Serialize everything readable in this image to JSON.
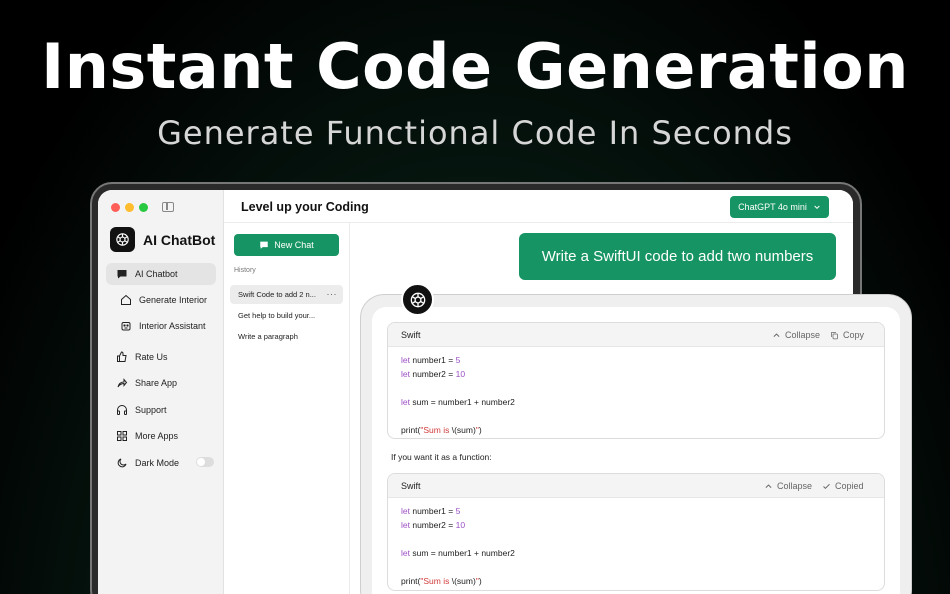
{
  "hero": {
    "title": "Instant Code Generation",
    "subtitle": "Generate Functional Code In Seconds"
  },
  "colors": {
    "accent": "#179463",
    "traffic_red": "#ff5f57",
    "traffic_yellow": "#febc2e",
    "traffic_green": "#28c840"
  },
  "sidebar": {
    "brand": "AI ChatBot",
    "items": [
      {
        "label": "AI Chatbot",
        "icon": "chat-bubble-icon"
      },
      {
        "label": "Generate Interior",
        "icon": "home-icon"
      },
      {
        "label": "Interior Assistant",
        "icon": "robot-icon"
      },
      {
        "label": "Rate Us",
        "icon": "thumbs-up-icon"
      },
      {
        "label": "Share App",
        "icon": "share-icon"
      },
      {
        "label": "Support",
        "icon": "headphones-icon"
      },
      {
        "label": "More Apps",
        "icon": "grid-icon"
      },
      {
        "label": "Dark Mode",
        "icon": "moon-icon"
      }
    ]
  },
  "topbar": {
    "title": "Level up your Coding",
    "model": "ChatGPT 4o mini"
  },
  "history": {
    "new_chat": "New Chat",
    "label": "History",
    "items": [
      "Swift Code to add 2 n...",
      "Get help to build your...",
      "Write a paragraph"
    ],
    "more": "···"
  },
  "chat": {
    "prompt": "Write a SwiftUI code to add two numbers",
    "between_text": "If you want it as a function:",
    "cards": [
      {
        "lang": "Swift",
        "collapse": "Collapse",
        "copy": "Copy",
        "lines": {
          "l1_kw": "let",
          "l1_rest": " number1 = ",
          "l1_num": "5",
          "l2_kw": "let",
          "l2_rest": " number2 = ",
          "l2_num": "10",
          "l3_kw": "let",
          "l3_rest": " sum = number1 + number2",
          "l4_pre": "print(",
          "l4_str": "\"Sum is ",
          "l4_mid": "\\(sum)",
          "l4_str2": "\"",
          "l4_post": ")"
        }
      },
      {
        "lang": "Swift",
        "collapse": "Collapse",
        "copy": "Copied",
        "lines": {
          "l1_kw": "let",
          "l1_rest": " number1 = ",
          "l1_num": "5",
          "l2_kw": "let",
          "l2_rest": " number2 = ",
          "l2_num": "10",
          "l3_kw": "let",
          "l3_rest": " sum = number1 + number2",
          "l4_pre": "print(",
          "l4_str": "\"Sum is ",
          "l4_mid": "\\(sum)",
          "l4_str2": "\"",
          "l4_post": ")"
        }
      }
    ]
  }
}
